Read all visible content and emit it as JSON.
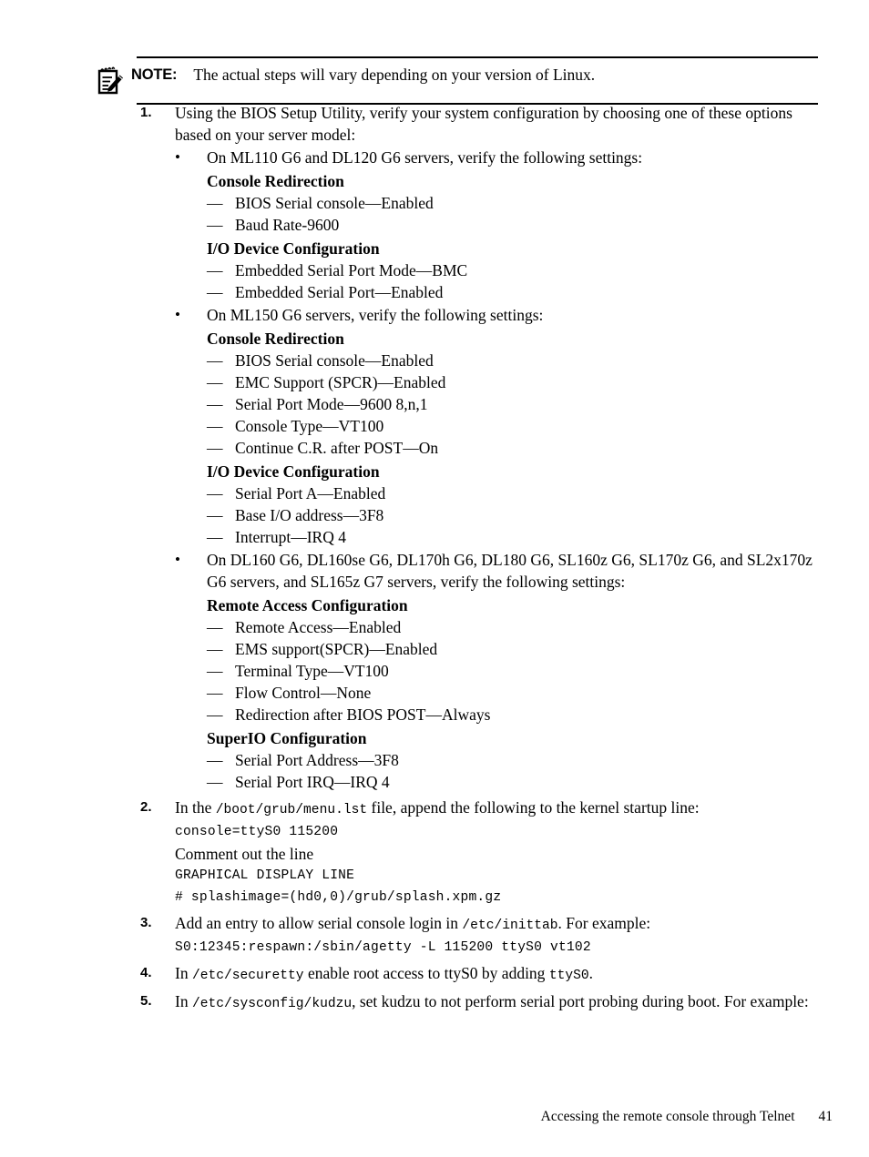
{
  "note": {
    "icon": "note-pencil-icon",
    "label": "NOTE:",
    "text": "The actual steps will vary depending on your version of Linux."
  },
  "steps": [
    {
      "number": "1.",
      "text": "Using the BIOS Setup Utility, verify your system configuration by choosing one of these options based on your server model:",
      "bullets": [
        {
          "text": "On ML110 G6 and DL120 G6 servers, verify the following settings:",
          "groups": [
            {
              "heading": "Console Redirection",
              "items": [
                "BIOS Serial console—Enabled",
                "Baud Rate-9600"
              ]
            },
            {
              "heading": "I/O Device Configuration",
              "items": [
                "Embedded Serial Port Mode—BMC",
                "Embedded Serial Port—Enabled"
              ]
            }
          ]
        },
        {
          "text": "On ML150 G6 servers, verify the following settings:",
          "groups": [
            {
              "heading": "Console Redirection",
              "items": [
                "BIOS Serial console—Enabled",
                "EMC Support (SPCR)—Enabled",
                "Serial Port Mode—9600 8,n,1",
                "Console Type—VT100",
                "Continue C.R. after POST—On"
              ]
            },
            {
              "heading": "I/O Device Configuration",
              "items": [
                "Serial Port A—Enabled",
                "Base I/O address—3F8",
                "Interrupt—IRQ 4"
              ]
            }
          ]
        },
        {
          "text": "On DL160 G6, DL160se G6, DL170h G6, DL180 G6, SL160z G6, SL170z G6, and SL2x170z G6 servers, and SL165z G7 servers, verify the following settings:",
          "groups": [
            {
              "heading": "Remote Access Configuration",
              "items": [
                "Remote Access—Enabled",
                "EMS support(SPCR)—Enabled",
                "Terminal Type—VT100",
                "Flow Control—None",
                "Redirection after BIOS POST—Always"
              ]
            },
            {
              "heading": "SuperIO Configuration",
              "items": [
                "Serial Port Address—3F8",
                "Serial Port IRQ—IRQ 4"
              ]
            }
          ]
        }
      ]
    },
    {
      "number": "2.",
      "text_parts": [
        {
          "t": "In the ",
          "mono": false
        },
        {
          "t": "/boot/grub/menu.lst",
          "mono": true
        },
        {
          "t": " file, append the following to the kernel startup line:",
          "mono": false
        }
      ],
      "lines": [
        {
          "kind": "code",
          "text": "console=ttyS0 115200"
        },
        {
          "kind": "plain",
          "text": "Comment out the line"
        },
        {
          "kind": "code",
          "text": "GRAPHICAL DISPLAY LINE"
        },
        {
          "kind": "code",
          "text": "# splashimage=(hd0,0)/grub/splash.xpm.gz"
        }
      ]
    },
    {
      "number": "3.",
      "text_parts": [
        {
          "t": "Add an entry to allow serial console login in ",
          "mono": false
        },
        {
          "t": "/etc/inittab",
          "mono": true
        },
        {
          "t": ". For example:",
          "mono": false
        }
      ],
      "lines": [
        {
          "kind": "code",
          "text": "S0:12345:respawn:/sbin/agetty -L 115200 ttyS0 vt102"
        }
      ]
    },
    {
      "number": "4.",
      "text_parts": [
        {
          "t": "In ",
          "mono": false
        },
        {
          "t": "/etc/securetty",
          "mono": true
        },
        {
          "t": " enable root access to ttyS0 by adding ",
          "mono": false
        },
        {
          "t": "ttyS0",
          "mono": true
        },
        {
          "t": ".",
          "mono": false
        }
      ],
      "lines": []
    },
    {
      "number": "5.",
      "text_parts": [
        {
          "t": "In ",
          "mono": false
        },
        {
          "t": "/etc/sysconfig/kudzu",
          "mono": true
        },
        {
          "t": ", set kudzu to not perform serial port probing during boot. For example:",
          "mono": false
        }
      ],
      "lines": []
    }
  ],
  "footer": {
    "title": "Accessing the remote console through Telnet",
    "page_number": "41"
  }
}
